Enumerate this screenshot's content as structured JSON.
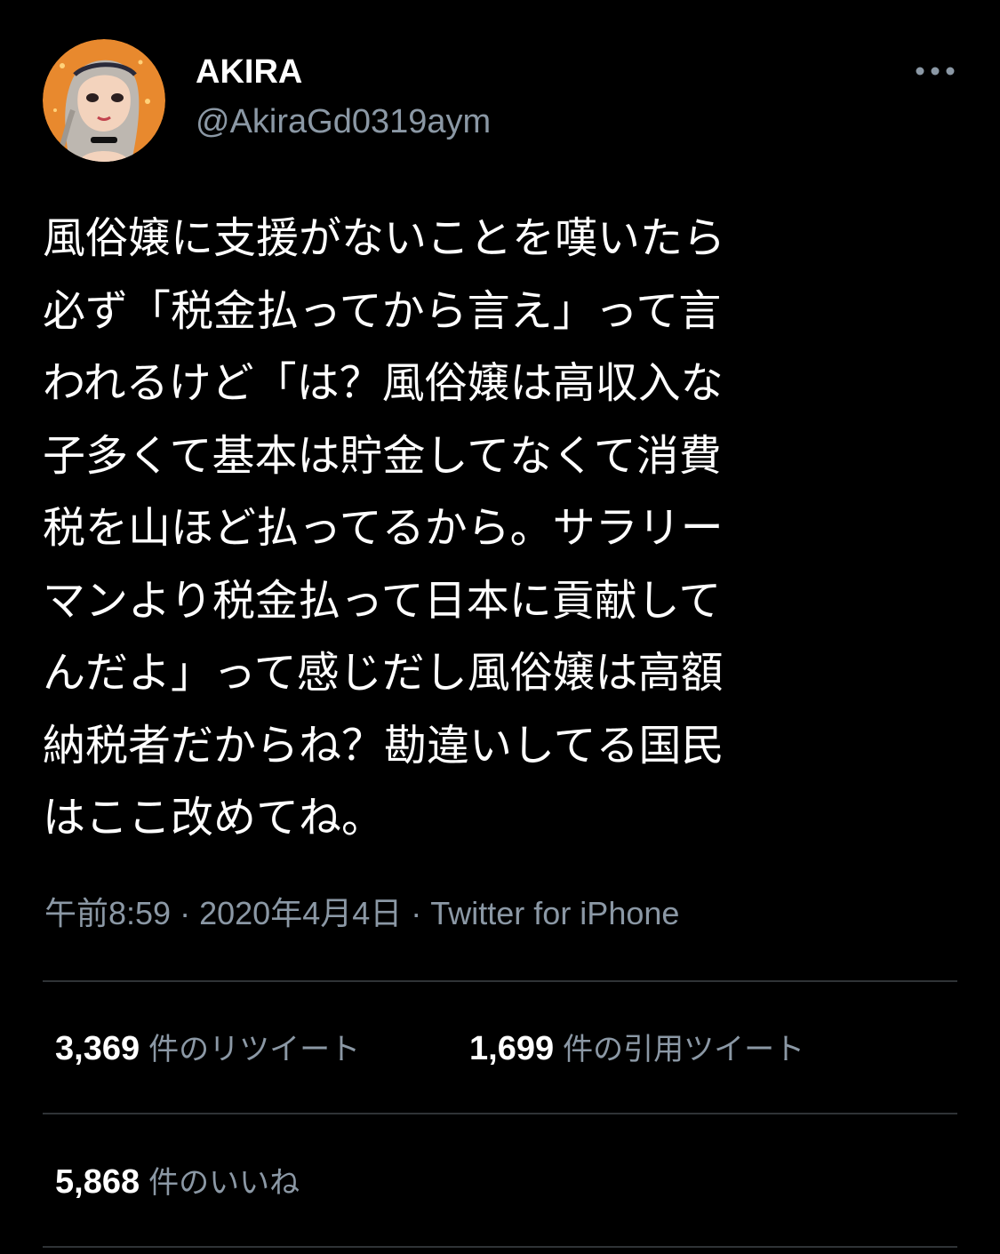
{
  "author": {
    "display_name": "AKIRA",
    "handle": "@AkiraGd0319aym",
    "avatar_icon": "user-avatar-illustration"
  },
  "more_icon": "more-horizontal-icon",
  "tweet": {
    "text": "風俗嬢に支援がないことを嘆いたら\n必ず「税金払ってから言え」って言\nわれるけど「は？風俗嬢は高収入な\n子多くて基本は貯金してなくて消費\n税を山ほど払ってるから。サラリー\nマンより税金払って日本に貢献して\nんだよ」って感じだし風俗嬢は高額\n納税者だからね？勘違いしてる国民\nはここ改めてね。",
    "time": "午前8:59",
    "date": "2020年4月4日",
    "separator": "·",
    "source": "Twitter for iPhone"
  },
  "stats": {
    "retweets": {
      "count": "3,369",
      "label": "件のリツイート"
    },
    "quotes": {
      "count": "1,699",
      "label": "件の引用ツイート"
    },
    "likes": {
      "count": "5,868",
      "label": "件のいいね"
    }
  },
  "colors": {
    "background": "#000000",
    "text_primary": "#ffffff",
    "text_secondary": "#8b98a5",
    "divider": "#2f3336",
    "avatar_bg": "#e8892e"
  }
}
